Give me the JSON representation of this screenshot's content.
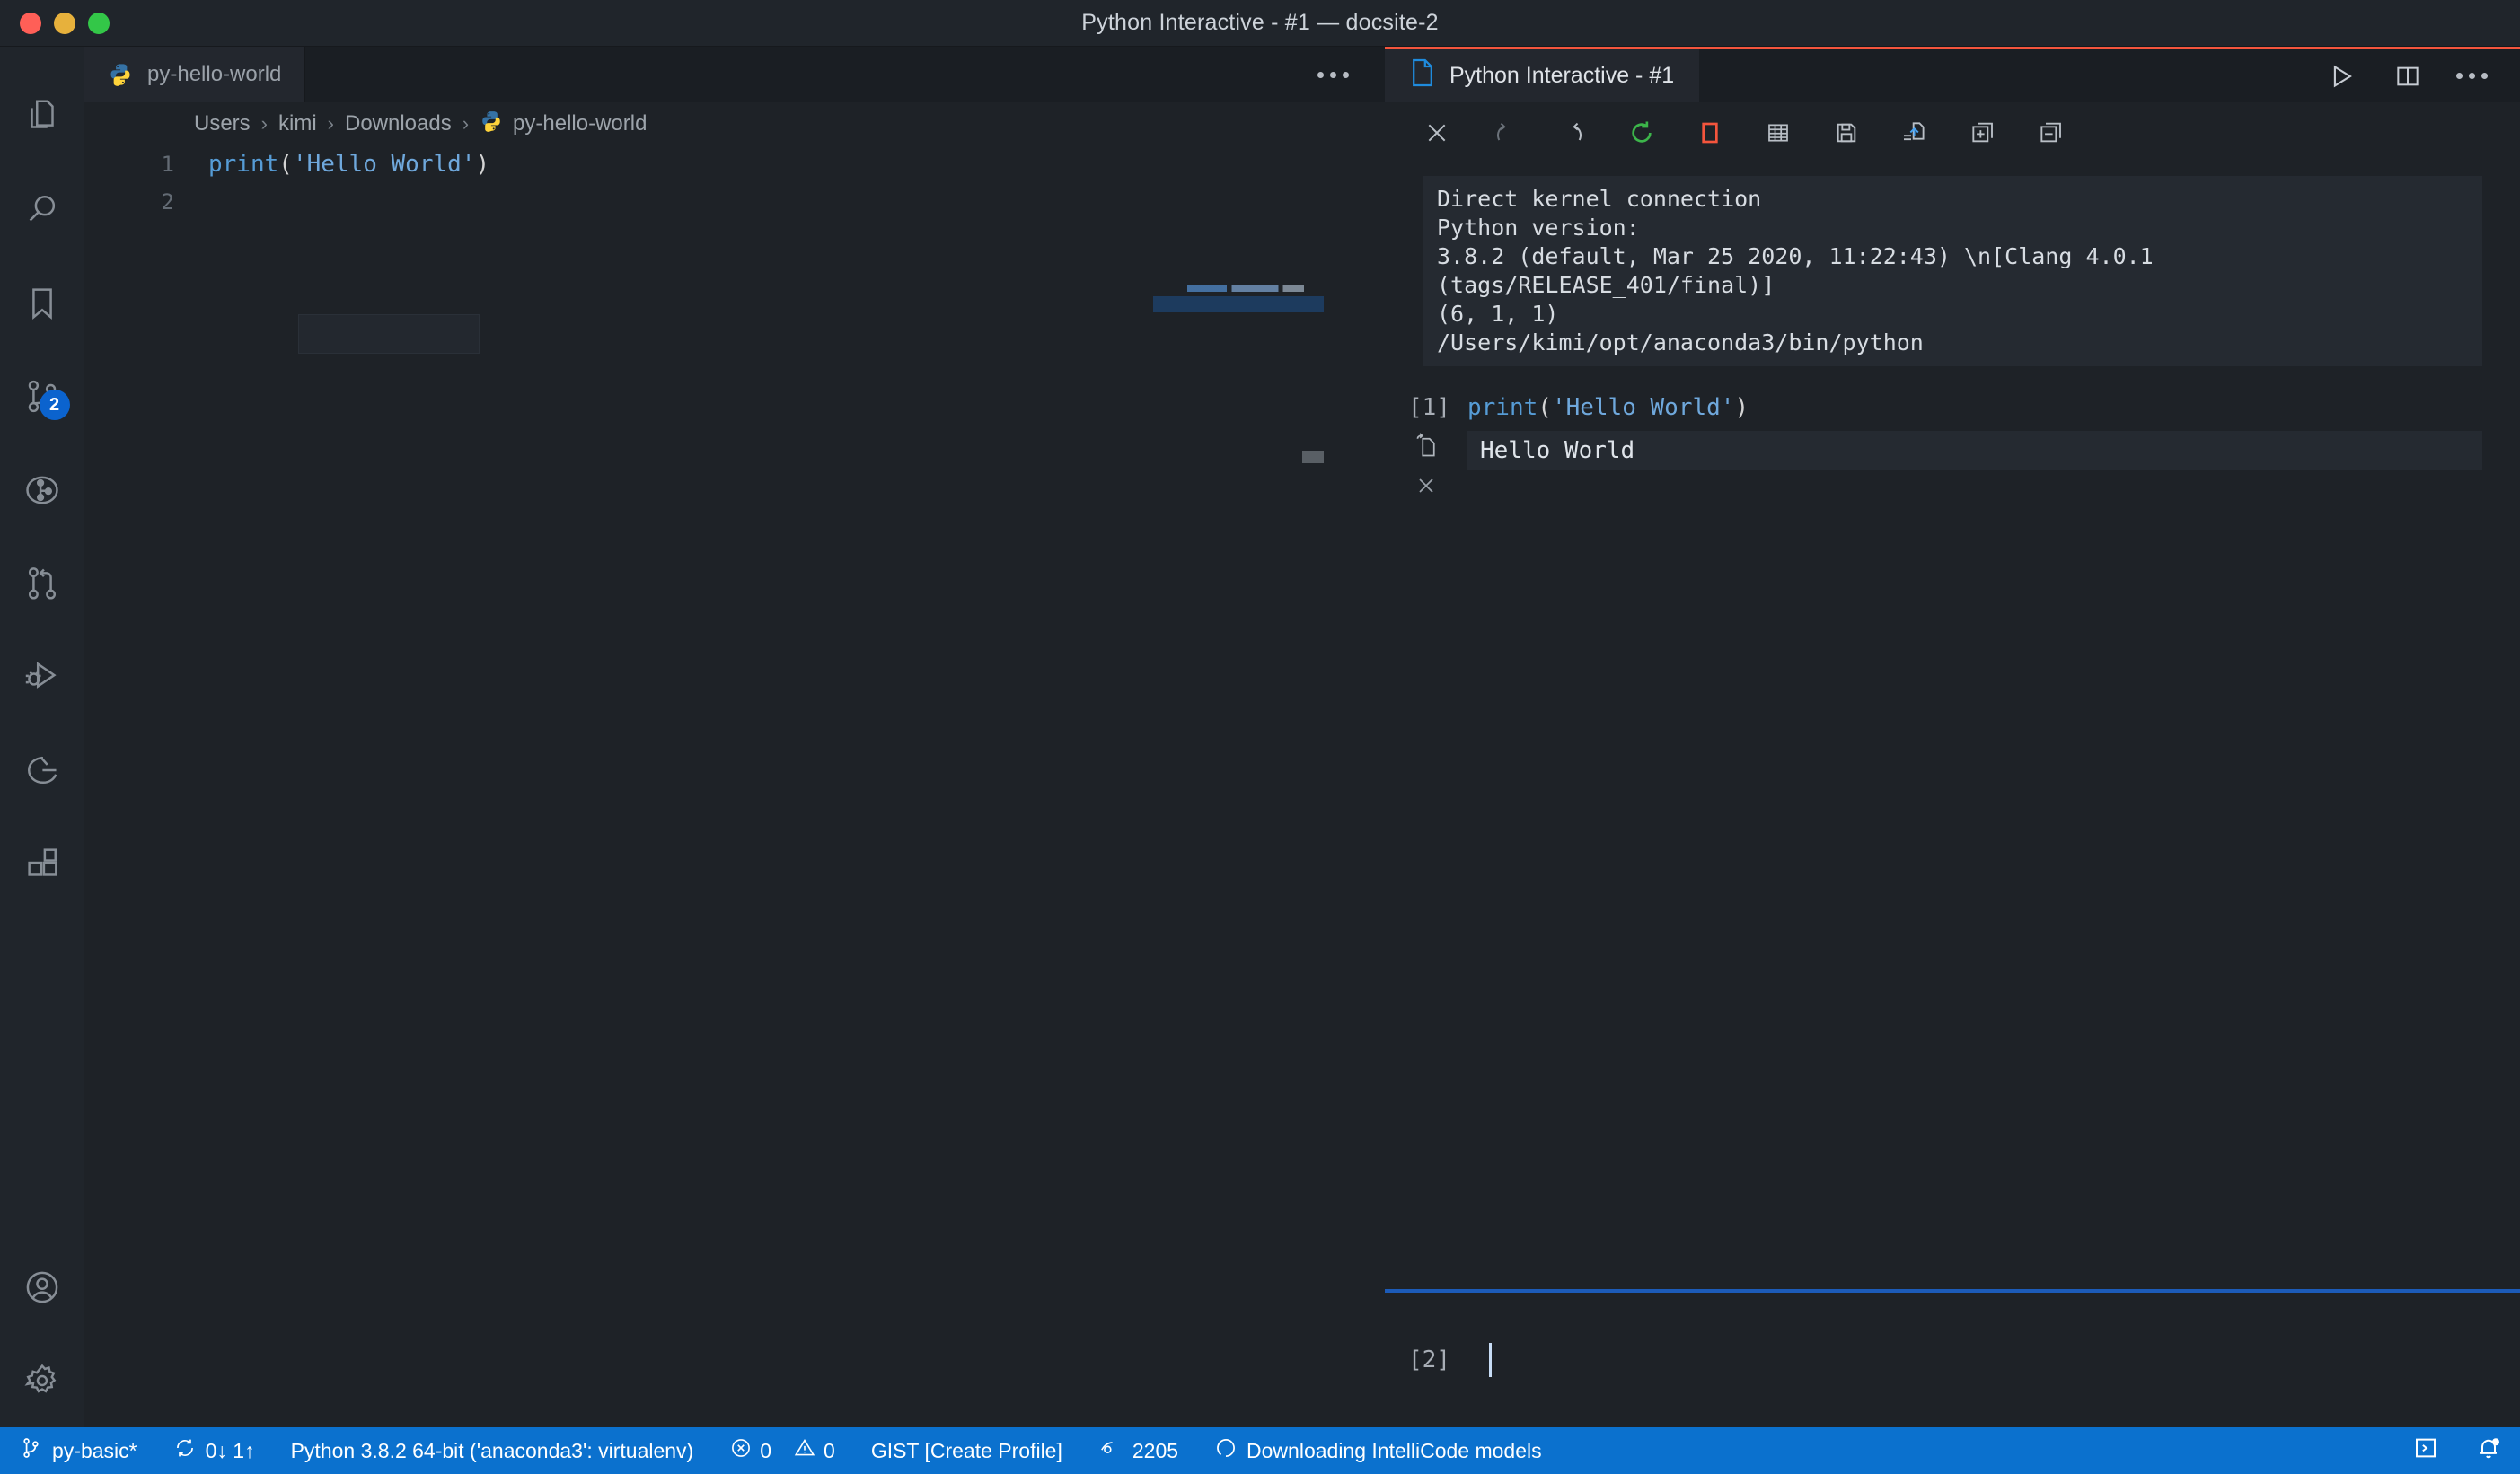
{
  "window": {
    "title": "Python Interactive - #1 — docsite-2",
    "traffic_lights": [
      "close-red",
      "minimize-yellow",
      "maximize-green"
    ],
    "accent_orange": "#f4553d",
    "accent_blue": "#1c5bb8",
    "statusbar_blue": "#0b71ce"
  },
  "activity_bar": {
    "items": [
      {
        "name": "explorer",
        "icon": "files-icon",
        "badge": null
      },
      {
        "name": "search",
        "icon": "search-icon",
        "badge": null
      },
      {
        "name": "bookmarks",
        "icon": "bookmark-icon",
        "badge": null
      },
      {
        "name": "source-control",
        "icon": "source-control-icon",
        "badge": "2"
      },
      {
        "name": "timeline",
        "icon": "git-graph-circle-icon",
        "badge": null
      },
      {
        "name": "pull-requests",
        "icon": "pull-request-icon",
        "badge": null
      },
      {
        "name": "run-and-debug",
        "icon": "run-debug-icon",
        "badge": null
      },
      {
        "name": "remote-explorer",
        "icon": "remote-explorer-icon",
        "badge": null
      },
      {
        "name": "extensions",
        "icon": "extensions-icon",
        "badge": null
      }
    ],
    "bottom_items": [
      {
        "name": "accounts",
        "icon": "account-icon"
      },
      {
        "name": "manage",
        "icon": "gear-icon"
      }
    ]
  },
  "editor": {
    "tab": {
      "label": "py-hello-world",
      "icon": "python-icon"
    },
    "more_actions": "editor-more-actions",
    "breadcrumb": [
      "Users",
      "kimi",
      "Downloads",
      "py-hello-world"
    ],
    "breadcrumb_separator": "›",
    "lines": [
      {
        "number": "1",
        "fn": "print",
        "open": "(",
        "string": "'Hello World'",
        "close": ")"
      },
      {
        "number": "2",
        "fn": "",
        "open": "",
        "string": "",
        "close": ""
      }
    ]
  },
  "interactive": {
    "tab": {
      "label": "Python Interactive - #1",
      "icon": "notebook-file-icon"
    },
    "tab_actions": [
      {
        "name": "run-button",
        "icon": "play-icon"
      },
      {
        "name": "split-editor-button",
        "icon": "split-editor-icon"
      },
      {
        "name": "more-actions-button",
        "icon": "ellipsis-icon"
      }
    ],
    "toolbar": [
      {
        "name": "clear-all-button",
        "icon": "close-x-icon",
        "color": "#b9bfc6"
      },
      {
        "name": "redo-button",
        "icon": "redo-icon",
        "color": "#6b727a"
      },
      {
        "name": "undo-button",
        "icon": "undo-icon",
        "color": "#b9bfc6"
      },
      {
        "name": "restart-kernel-button",
        "icon": "restart-icon",
        "color": "#3cb54a"
      },
      {
        "name": "interrupt-kernel-button",
        "icon": "stop-square-icon",
        "color": "#f4553d"
      },
      {
        "name": "variables-button",
        "icon": "table-grid-icon",
        "color": "#b9bfc6"
      },
      {
        "name": "save-notebook-button",
        "icon": "save-floppy-icon",
        "color": "#b9bfc6"
      },
      {
        "name": "export-button",
        "icon": "export-icon",
        "color": "#b9bfc6"
      },
      {
        "name": "expand-all-button",
        "icon": "expand-all-icon",
        "color": "#b9bfc6"
      },
      {
        "name": "collapse-all-button",
        "icon": "collapse-all-icon",
        "color": "#b9bfc6"
      }
    ],
    "kernel_output": "Direct kernel connection\nPython version:\n3.8.2 (default, Mar 25 2020, 11:22:43) \\n[Clang 4.0.1 (tags/RELEASE_401/final)]\n(6, 1, 1)\n/Users/kimi/opt/anaconda3/bin/python",
    "cells": [
      {
        "prompt": "[1]",
        "code_fn": "print",
        "code_open": "(",
        "code_string": "'Hello World'",
        "code_close": ")",
        "goto_icon": "goto-code-icon",
        "delete_icon": "close-x-icon",
        "output": "Hello World"
      }
    ],
    "input_prompt": "[2]",
    "input_value": ""
  },
  "status_bar": {
    "left": [
      {
        "name": "branch",
        "icon": "source-control-branch-icon",
        "text": "py-basic*"
      },
      {
        "name": "sync",
        "icon": "sync-icon",
        "text": "0↓ 1↑"
      },
      {
        "name": "python-interpreter",
        "icon": "",
        "text": "Python 3.8.2 64-bit ('anaconda3': virtualenv)"
      },
      {
        "name": "problems",
        "icon": "error-warning-icons",
        "text": "0",
        "text2": "0"
      },
      {
        "name": "gist",
        "icon": "",
        "text": "GIST [Create Profile]"
      },
      {
        "name": "watch-count",
        "icon": "eye-icon",
        "text": "2205"
      },
      {
        "name": "intellicode",
        "icon": "loading-icon",
        "text": "Downloading IntelliCode models"
      }
    ],
    "right": [
      {
        "name": "open-remote-window",
        "icon": "remote-terminal-icon"
      },
      {
        "name": "notifications",
        "icon": "bell-dot-icon"
      }
    ]
  }
}
